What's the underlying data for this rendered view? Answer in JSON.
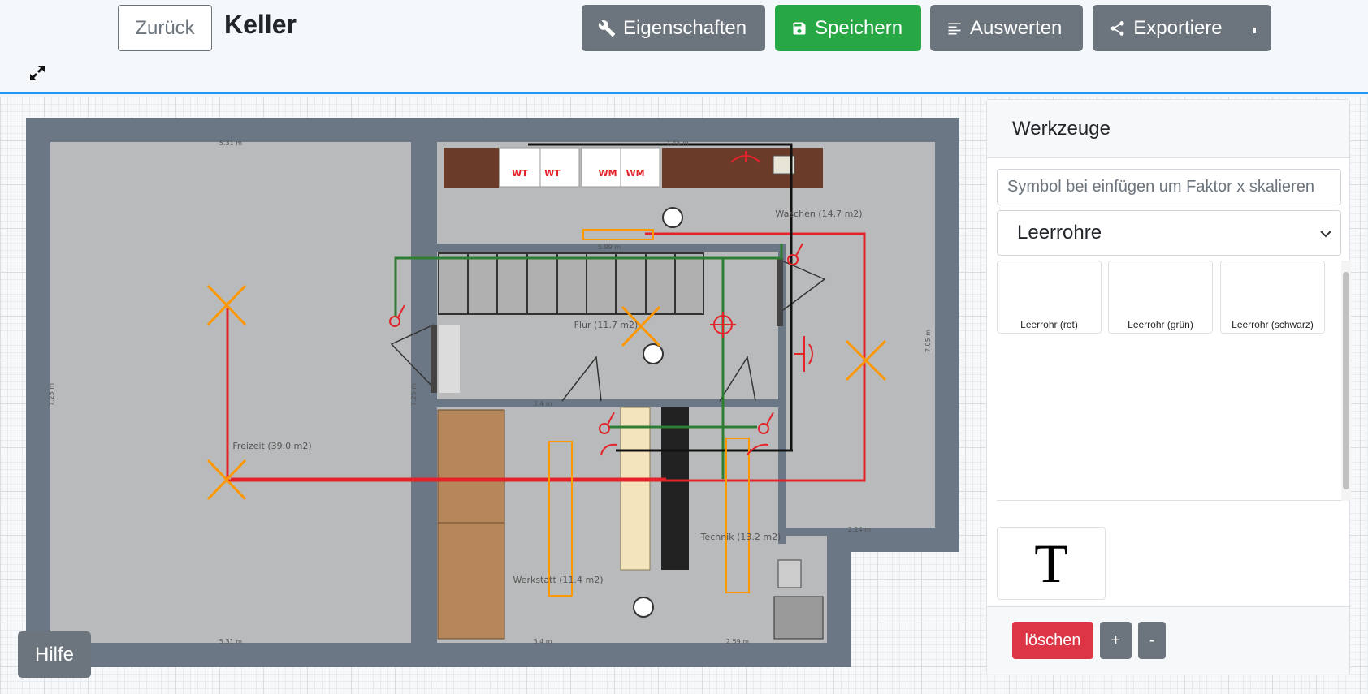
{
  "header": {
    "back_label": "Zurück",
    "title": "Keller",
    "buttons": {
      "properties": "Eigenschaften",
      "save": "Speichern",
      "evaluate": "Auswerten",
      "export": "Exportieren"
    },
    "expand_icon": "expand-arrows-icon"
  },
  "plan": {
    "rooms": {
      "freizeit": "Freizeit (39.0 m2)",
      "flur": "Flur (11.7 m2)",
      "waschen": "Waschen (14.7 m2)",
      "werkstatt": "Werkstatt (11.4 m2)",
      "technik": "Technik (13.2 m2)"
    },
    "dimensions": {
      "top_left": "5.31 m",
      "top_right": "7.45 m",
      "bottom_left": "5.31 m",
      "bottom_mid": "3.4 m",
      "bottom_right": "2.59 m",
      "flur_top": "5.99 m",
      "flur_bottom": "3.4 m",
      "waschen_bottom": "2.14 m",
      "left_side": "7.25 m",
      "mid_side": "7.25 m",
      "right_side": "7.05 m"
    },
    "appliances": [
      "WT",
      "WT",
      "WM",
      "WM"
    ],
    "colors": {
      "red_conduit": "#e4222a",
      "green_conduit": "#2e7d32",
      "black_conduit": "#111111",
      "orange_light": "#ff9800"
    }
  },
  "help_label": "Hilfe",
  "tools": {
    "title": "Werkzeuge",
    "scale_placeholder": "Symbol bei einfügen um Faktor x skalieren",
    "category": "Leerrohre",
    "symbols": [
      "Leerrohr (rot)",
      "Leerrohr (grün)",
      "Leerrohr (schwarz)"
    ],
    "text_tool": "T",
    "footer": {
      "delete": "löschen",
      "plus": "+",
      "minus": "-"
    }
  }
}
